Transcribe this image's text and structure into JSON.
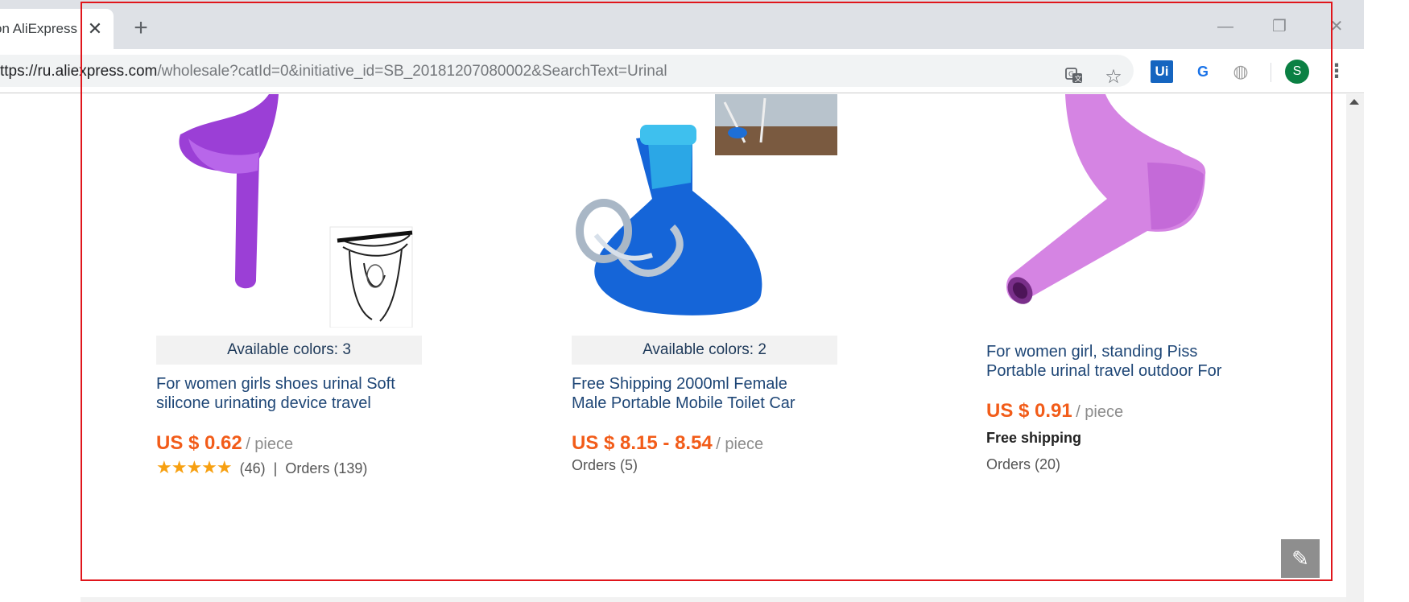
{
  "browser": {
    "tab_title": "Shopping on AliExpress",
    "tab_close": "✕",
    "new_tab": "+",
    "url_prefix": "ttps://ru.ali",
    "url_host": "express.com",
    "url_path": "/wholesale?catId=0&initiative_id=SB_20181207080002&SearchText=Urinal",
    "window": {
      "minimize": "—",
      "maximize": "❐",
      "close": "✕"
    },
    "extensions": {
      "ui": "Ui",
      "translate": "G",
      "globe": "◍"
    },
    "avatar_letter": "S",
    "menu": "⋮"
  },
  "products": [
    {
      "colors_label": "Available colors: 3",
      "title_line1": "For women girls shoes urinal Soft",
      "title_line2": "silicone urinating device travel",
      "price": "US $ 0.62",
      "unit": "/ piece",
      "stars": "★★★★★",
      "rating_count": "(46)",
      "separator": "|",
      "orders": "Orders (139)"
    },
    {
      "colors_label": "Available colors: 2",
      "title_line1": "Free Shipping 2000ml Female",
      "title_line2": "Male Portable Mobile Toilet Car",
      "price": "US $ 8.15 - 8.54",
      "unit": "/ piece",
      "orders": "Orders (5)"
    },
    {
      "title_line1": "For women girl, standing Piss",
      "title_line2": "Portable urinal travel outdoor For",
      "price": "US $ 0.91",
      "unit": "/ piece",
      "shipping": "Free shipping",
      "orders": "Orders (20)"
    }
  ],
  "colors": {
    "price": "#f25c19",
    "title": "#1e4676",
    "highlight": "#e0151b",
    "stars": "#f7a011"
  }
}
